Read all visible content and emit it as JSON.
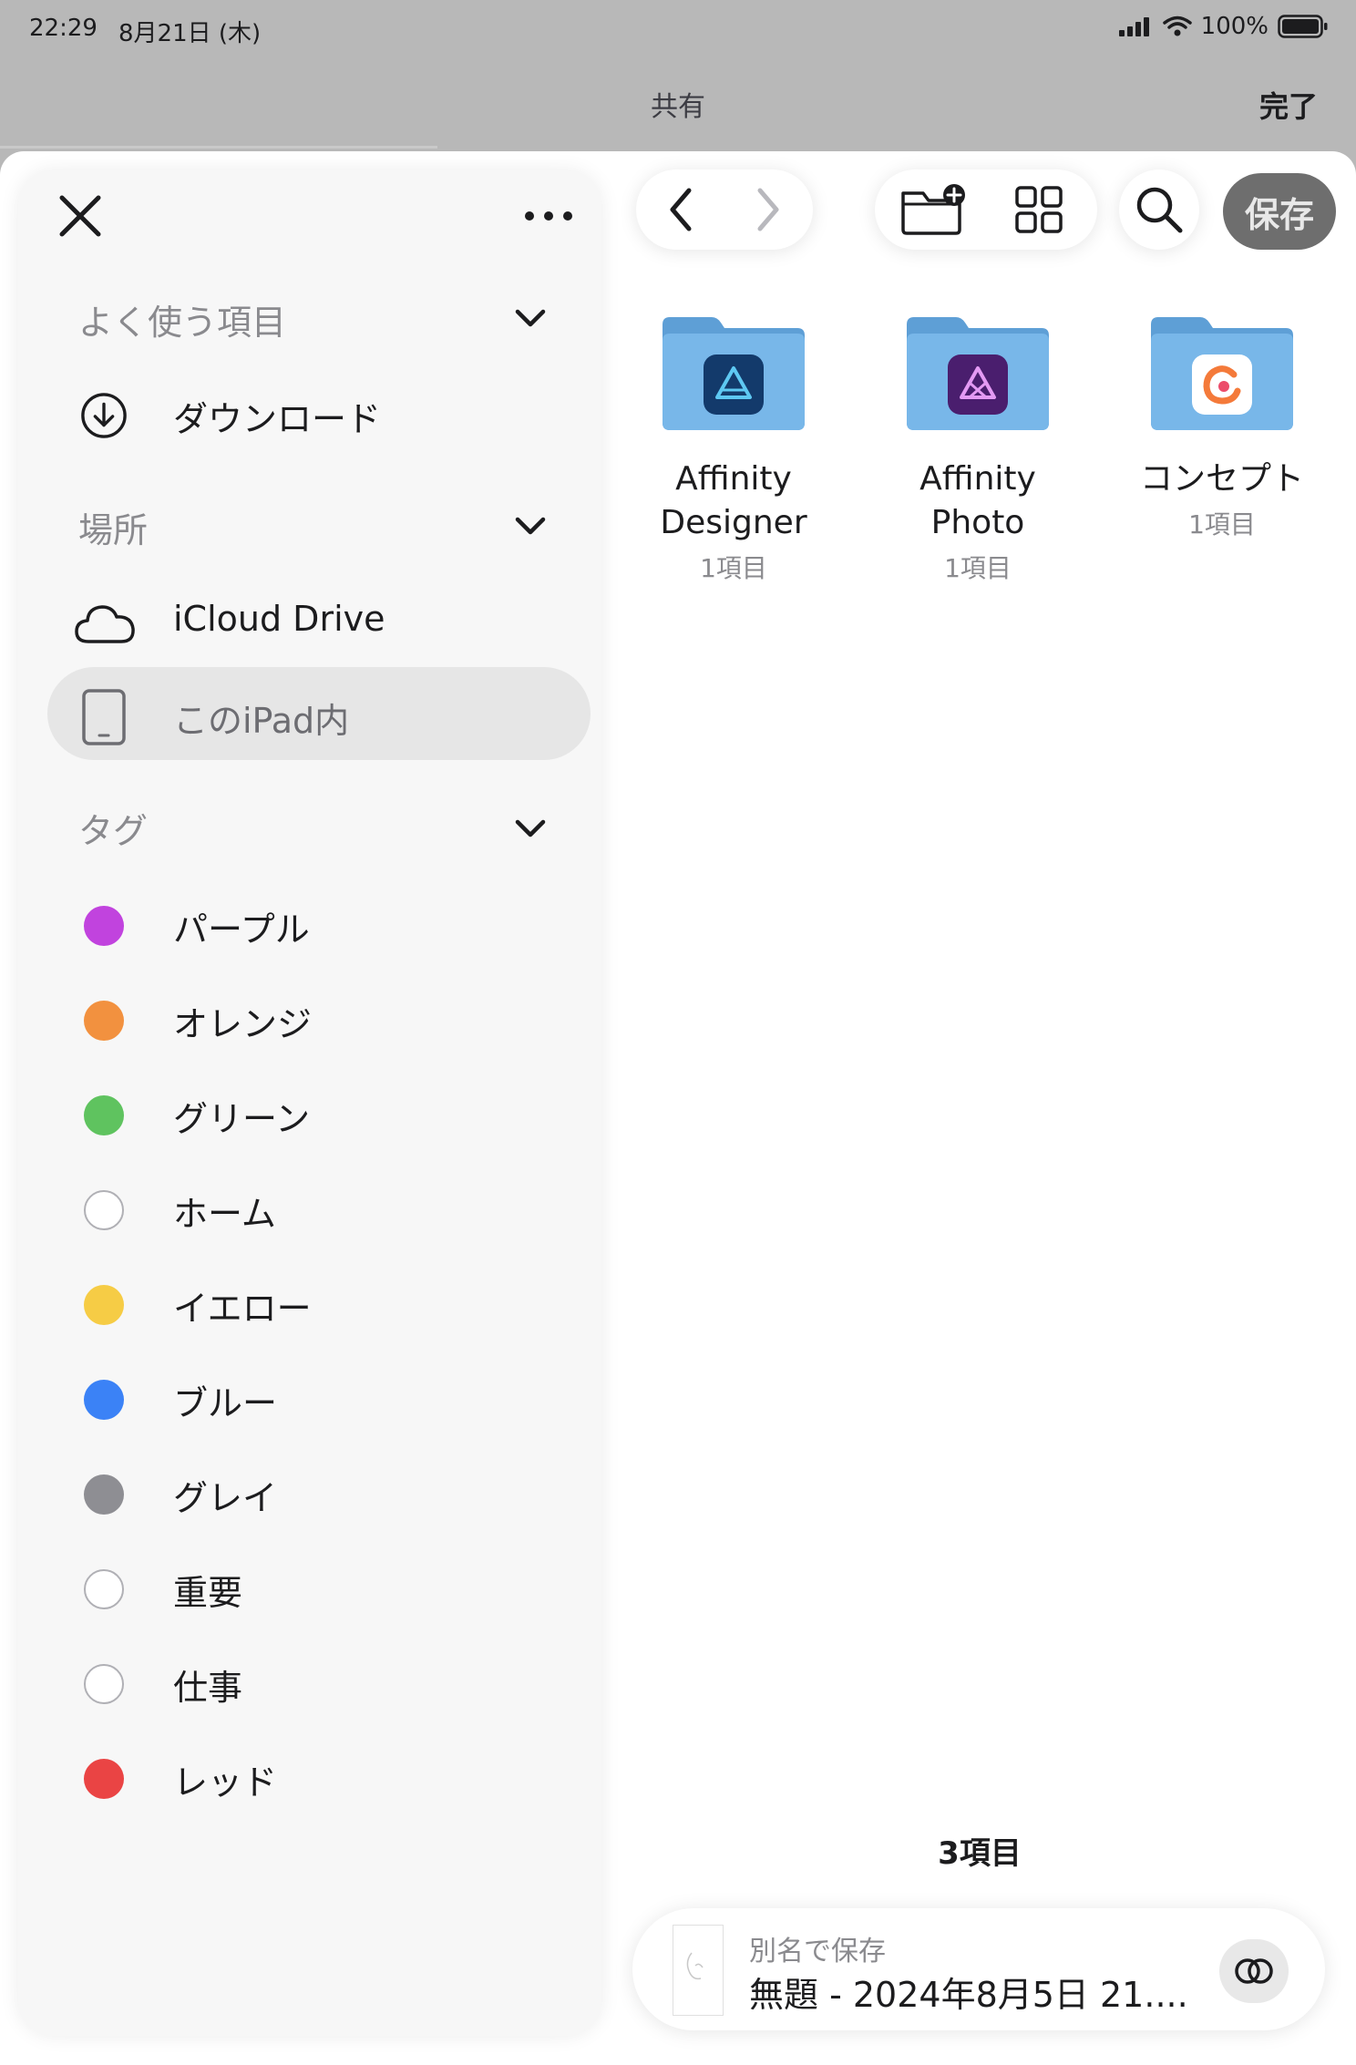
{
  "status_bar": {
    "time": "22:29",
    "date": "8月21日 (木)",
    "battery": "100%"
  },
  "header": {
    "title": "共有",
    "done_label": "完了"
  },
  "sidebar": {
    "favorites_header": "よく使う項目",
    "favorites": [
      {
        "label": "ダウンロード",
        "icon": "download-icon"
      }
    ],
    "locations_header": "場所",
    "locations": [
      {
        "label": "iCloud Drive",
        "icon": "cloud-icon"
      },
      {
        "label": "このiPad内",
        "icon": "ipad-icon",
        "selected": true
      }
    ],
    "tags_header": "タグ",
    "tags": [
      {
        "label": "パープル",
        "color": "#c143de"
      },
      {
        "label": "オレンジ",
        "color": "#f2913f"
      },
      {
        "label": "グリーン",
        "color": "#5fc35f"
      },
      {
        "label": "ホーム",
        "color": ""
      },
      {
        "label": "イエロー",
        "color": "#f6cc45"
      },
      {
        "label": "ブルー",
        "color": "#3b82f6"
      },
      {
        "label": "グレイ",
        "color": "#8e8e93"
      },
      {
        "label": "重要",
        "color": ""
      },
      {
        "label": "仕事",
        "color": ""
      },
      {
        "label": "レッド",
        "color": "#ea4444"
      }
    ]
  },
  "toolbar": {
    "save_label": "保存"
  },
  "folders": [
    {
      "name_lines": [
        "Affinity",
        "Designer"
      ],
      "count": "1項目",
      "app_icon": "affinity-designer-icon"
    },
    {
      "name_lines": [
        "Affinity Photo"
      ],
      "count": "1項目",
      "app_icon": "affinity-photo-icon"
    },
    {
      "name_lines": [
        "コンセプト"
      ],
      "count": "1項目",
      "app_icon": "concepts-icon"
    }
  ],
  "item_count": "3項目",
  "save_as": {
    "label": "別名で保存",
    "filename": "無題 - 2024年8月5日 21...."
  },
  "colors": {
    "folder_blue": "#6aaee3",
    "save_button": "#6e6e6e"
  }
}
